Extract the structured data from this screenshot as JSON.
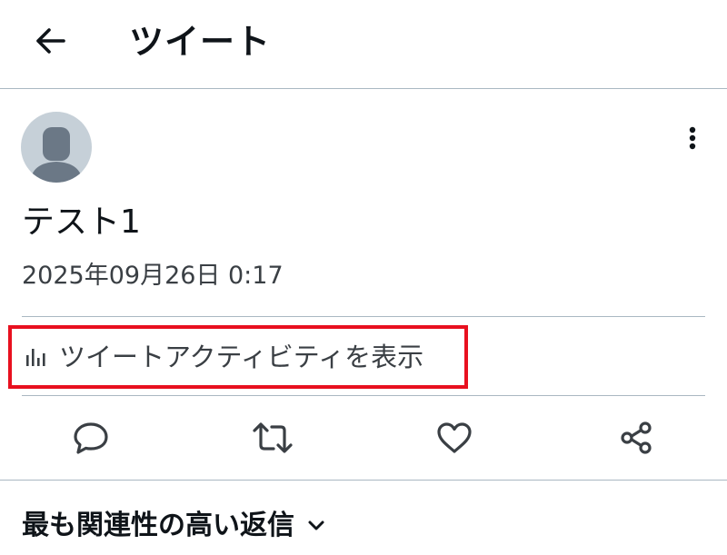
{
  "header": {
    "title": "ツイート",
    "back_icon": "arrow-left-icon"
  },
  "tweet": {
    "text": "テスト1",
    "timestamp": "2025年09月26日 0:17",
    "avatar_icon": "default-user-avatar",
    "more_icon": "vertical-ellipsis-icon"
  },
  "activity": {
    "label": "ツイートアクティビティを表示",
    "icon": "bar-chart-icon",
    "highlight_color": "#e8101f"
  },
  "actions": {
    "icons": [
      "reply-icon",
      "retweet-icon",
      "like-icon",
      "share-icon"
    ]
  },
  "replies": {
    "sort_label": "最も関連性の高い返信",
    "icon": "chevron-down-icon"
  },
  "colors": {
    "text": "#0f1419",
    "secondary_text": "#3a3f44",
    "divider": "#aab8c2",
    "avatar_bg": "#c6d0d8",
    "avatar_fg": "#6b7886"
  }
}
